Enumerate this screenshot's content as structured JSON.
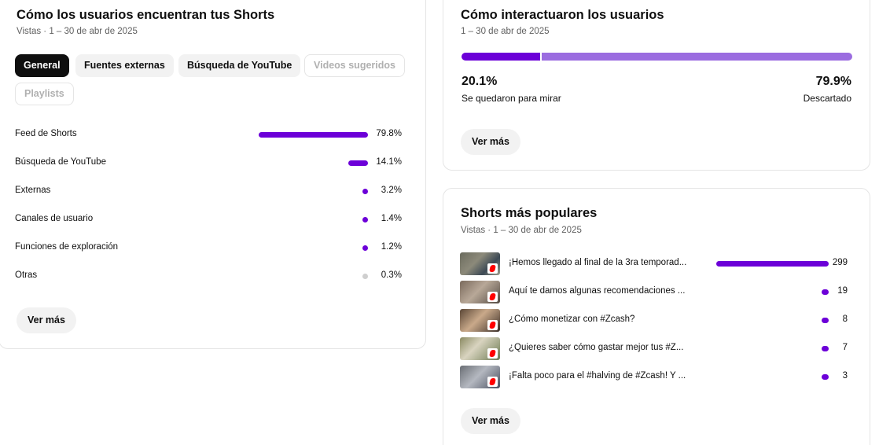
{
  "sources_card": {
    "title": "Cómo los usuarios encuentran tus Shorts",
    "subtitle": "Vistas · 1 – 30 de abr de 2025",
    "chips": [
      {
        "label": "General",
        "state": "active"
      },
      {
        "label": "Fuentes externas",
        "state": "normal"
      },
      {
        "label": "Búsqueda de YouTube",
        "state": "normal"
      },
      {
        "label": "Videos sugeridos",
        "state": "disabled"
      },
      {
        "label": "Playlists",
        "state": "disabled"
      }
    ],
    "rows": [
      {
        "label": "Feed de Shorts",
        "value": "79.8%",
        "percent": 79.8,
        "color": "#6c00d8"
      },
      {
        "label": "Búsqueda de YouTube",
        "value": "14.1%",
        "percent": 14.1,
        "color": "#6c00d8"
      },
      {
        "label": "Externas",
        "value": "3.2%",
        "percent": 3.2,
        "color": "#6c00d8"
      },
      {
        "label": "Canales de usuario",
        "value": "1.4%",
        "percent": 1.4,
        "color": "#6c00d8"
      },
      {
        "label": "Funciones de exploración",
        "value": "1.2%",
        "percent": 1.2,
        "color": "#6c00d8"
      },
      {
        "label": "Otras",
        "value": "0.3%",
        "percent": 0.3,
        "color": "#cfcfcf"
      }
    ],
    "more_label": "Ver más"
  },
  "interaction_card": {
    "title": "Cómo interactuaron los usuarios",
    "subtitle": "1 – 30 de abr de 2025",
    "stayed_pct": "20.1%",
    "stayed_value": 20.1,
    "stayed_label": "Se quedaron para mirar",
    "swiped_pct": "79.9%",
    "swiped_value": 79.9,
    "swiped_label": "Descartado",
    "colors": {
      "stayed": "#6c00d8",
      "swiped": "#9b6ce0"
    },
    "more_label": "Ver más"
  },
  "popular_card": {
    "title": "Shorts más populares",
    "subtitle": "Vistas · 1 – 30 de abr de 2025",
    "items": [
      {
        "title": "¡Hemos llegado al final de la 3ra temporad...",
        "views": "299",
        "value": 299
      },
      {
        "title": "Aquí te damos algunas recomendaciones ...",
        "views": "19",
        "value": 19
      },
      {
        "title": "¿Cómo monetizar con #Zcash?",
        "views": "8",
        "value": 8
      },
      {
        "title": "¿Quieres saber cómo gastar mejor tus #Z...",
        "views": "7",
        "value": 7
      },
      {
        "title": "¡Falta poco para el #halving de #Zcash! Y ...",
        "views": "3",
        "value": 3
      }
    ],
    "thumb_icon": "shorts-icon",
    "bar_color": "#6c00d8",
    "more_label": "Ver más"
  }
}
